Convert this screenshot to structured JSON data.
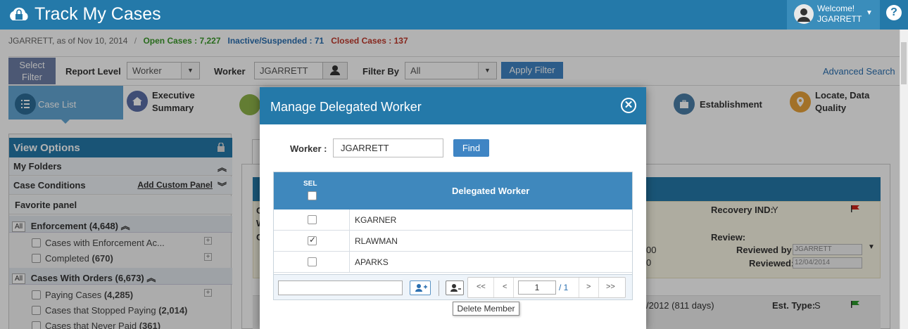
{
  "header": {
    "app_title": "Track My Cases",
    "welcome_label": "Welcome!",
    "welcome_user": "JGARRETT",
    "help_glyph": "?"
  },
  "status": {
    "user_date": "JGARRETT, as of Nov 10, 2014",
    "separator": "/",
    "open_cases": "Open Cases : 7,227",
    "inactive": "Inactive/Suspended : 71",
    "closed": "Closed Cases : 137"
  },
  "filters": {
    "select_filter_line1": "Select",
    "select_filter_line2": "Filter",
    "report_level_label": "Report Level",
    "report_level_value": "Worker",
    "worker_label": "Worker",
    "worker_value": "JGARRETT",
    "filter_by_label": "Filter By",
    "filter_by_value": "All",
    "apply_label": "Apply Filter",
    "advanced_search": "Advanced Search"
  },
  "tabs": {
    "case_list": "Case List",
    "exec_line1": "Executive",
    "exec_line2": "Summary",
    "establishment": "Establishment",
    "locate_line1": "Locate, Data",
    "locate_line2": "Quality"
  },
  "left_panel": {
    "view_options": "View Options",
    "my_folders": "My Folders",
    "case_conditions": "Case Conditions",
    "add_custom_panel": "Add Custom Panel",
    "favorite_panel": "Favorite panel",
    "all_badge": "All",
    "enforcement": "Enforcement (4,648)",
    "enf_items": [
      {
        "label": "Cases with Enforcement Ac...",
        "count": ""
      },
      {
        "label": "Completed",
        "count": "(670)"
      }
    ],
    "orders": "Cases With Orders (6,673)",
    "order_items": [
      {
        "label": "Paying Cases",
        "count": "(4,285)"
      },
      {
        "label": "Cases that Stopped Paying",
        "count": "(2,014)"
      },
      {
        "label": "Cases that Never Paid",
        "count": "(361)"
      }
    ]
  },
  "background": {
    "recovery_ind": "Recovery IND:",
    "recovery_val": "Y",
    "review": "Review:",
    "reviewed_by": "Reviewed by:",
    "reviewed_by_val": "JGARRETT",
    "reviewed": "Reviewed:",
    "reviewed_val": "12/04/2014",
    "frag_00": "00",
    "frag_0": "0",
    "frag_date": "/2012 (811 days)",
    "est_type": "Est. Type:",
    "est_type_val": "S",
    "frag_c": "C",
    "frag_w": "W"
  },
  "modal": {
    "title": "Manage Delegated Worker",
    "worker_label": "Worker :",
    "worker_value": "JGARRETT",
    "find_label": "Find",
    "sel_header": "SEL",
    "col_header": "Delegated Worker",
    "rows": [
      {
        "name": "KGARNER",
        "checked": false
      },
      {
        "name": "RLAWMAN",
        "checked": true
      },
      {
        "name": "APARKS",
        "checked": false
      }
    ],
    "pager": {
      "first": "<<",
      "prev": "<",
      "page": "1",
      "total": "/ 1",
      "next": ">",
      "last": ">>"
    },
    "tooltip": "Delete Member"
  },
  "colors": {
    "primary": "#2479a9",
    "open": "#3c9a2a",
    "inactive": "#2a6fb0",
    "closed": "#c0392b"
  },
  "icons": [
    "cloud-lock-icon",
    "user-avatar-icon",
    "help-icon",
    "user-icon",
    "list-icon",
    "home-icon",
    "send-icon",
    "briefcase-icon",
    "location-pin-icon",
    "lock-icon",
    "close-icon",
    "add-user-icon",
    "remove-user-icon",
    "flag-icon"
  ]
}
